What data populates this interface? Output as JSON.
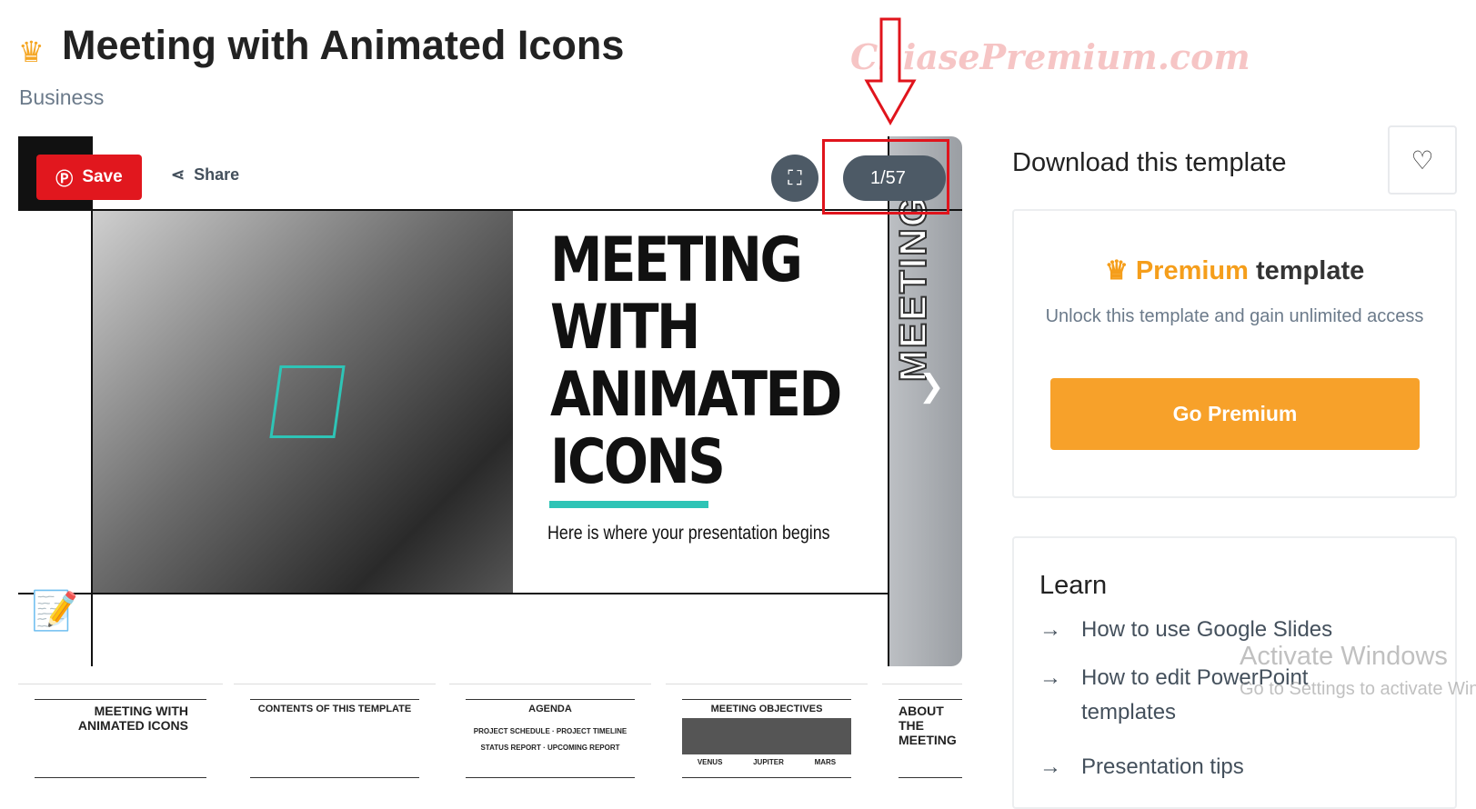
{
  "header": {
    "title": "Meeting with Animated Icons",
    "category": "Business",
    "crown_icon": "crown-icon"
  },
  "watermark": "ChiasePremium.com",
  "preview": {
    "save_label": "Save",
    "share_label": "Share",
    "counter": "1/57",
    "slide": {
      "title_lines": [
        "MEETING",
        "WITH",
        "ANIMATED",
        "ICONS"
      ],
      "subtitle": "Here is where your presentation begins",
      "side_text": "MEETING",
      "accent": "#2ec4b6"
    }
  },
  "thumbnails": [
    {
      "title": "MEETING WITH ANIMATED ICONS"
    },
    {
      "title": "CONTENTS OF THIS TEMPLATE"
    },
    {
      "title": "AGENDA",
      "items": [
        "PROJECT SCHEDULE",
        "PROJECT TIMELINE",
        "STATUS REPORT",
        "UPCOMING REPORT"
      ]
    },
    {
      "title": "MEETING OBJECTIVES",
      "items": [
        "VENUS",
        "JUPITER",
        "MARS"
      ]
    },
    {
      "title": "ABOUT THE MEETING"
    }
  ],
  "sidebar": {
    "download_title": "Download this template",
    "premium": {
      "highlight": "Premium",
      "rest": "template",
      "desc": "Unlock this template and gain unlimited access",
      "button": "Go Premium"
    },
    "learn": {
      "title": "Learn",
      "links": [
        "How to use Google Slides",
        "How to edit PowerPoint templates",
        "Presentation tips"
      ]
    }
  },
  "os_overlay": {
    "line1": "Activate Windows",
    "line2": "Go to Settings to activate Windows."
  },
  "colors": {
    "save": "#e1171e",
    "premium": "#f7a12a",
    "highlight_box": "#e0141c"
  }
}
